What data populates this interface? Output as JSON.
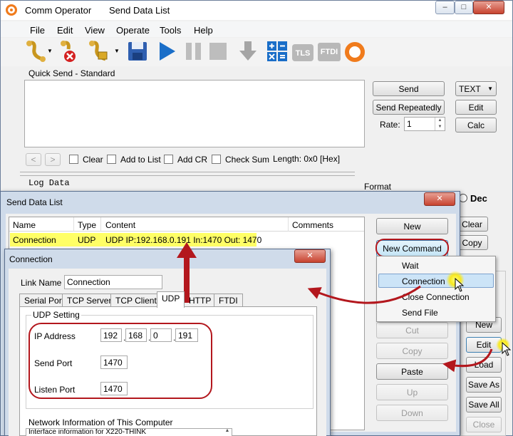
{
  "main_window": {
    "app_name": "Comm Operator",
    "doc_title": "Send Data List",
    "menu": [
      "File",
      "Edit",
      "View",
      "Operate",
      "Tools",
      "Help"
    ],
    "quick_send_title": "Quick Send - Standard",
    "send_label": "Send",
    "send_repeatedly_label": "Send Repeatedly",
    "rate_label": "Rate:",
    "rate_value": "1",
    "format_select": "TEXT",
    "edit_label": "Edit",
    "calc_label": "Calc",
    "prev_arrow": "<",
    "next_arrow": ">",
    "clear_label": "Clear",
    "add_to_list_label": "Add to List",
    "add_cr_label": "Add CR",
    "check_sum_label": "Check Sum",
    "length_text": "Length: 0x0 [Hex]",
    "log_data_label": "Log Data",
    "format_label": "Format",
    "dec_label": "Dec",
    "right_clear": "Clear",
    "right_copy": "Copy",
    "right_new": "New",
    "right_edit": "Edit",
    "right_load": "Load",
    "right_save_as": "Save As",
    "right_save_all": "Save All",
    "right_close": "Close",
    "toolbar_tls": "TLS",
    "toolbar_ftdi": "FTDI"
  },
  "send_data_list": {
    "title": "Send Data List",
    "columns": [
      "Name",
      "Type",
      "Content",
      "Comments"
    ],
    "rows": [
      {
        "name": "Connection",
        "type": "UDP",
        "content": "UDP IP:192.168.0.191 In:1470 Out: 1470",
        "comments": ""
      }
    ],
    "buttons": {
      "new": "New",
      "new_command": "New Command",
      "cut": "Cut",
      "copy": "Copy",
      "paste": "Paste",
      "up": "Up",
      "down": "Down"
    }
  },
  "context_menu": {
    "items": [
      "Wait",
      "Connection",
      "Close Connection",
      "Send File"
    ],
    "highlighted": "Connection"
  },
  "connection_dialog": {
    "title": "Connection",
    "link_name_label": "Link Name",
    "link_name_value": "Connection",
    "tabs": [
      "Serial Port",
      "TCP Server",
      "TCP Client",
      "UDP",
      "HTTP",
      "FTDI"
    ],
    "active_tab": "UDP",
    "udp_group_label": "UDP Setting",
    "ip_label": "IP Address",
    "ip_octets": [
      "192",
      "168",
      "0",
      "191"
    ],
    "send_port_label": "Send Port",
    "send_port_value": "1470",
    "listen_port_label": "Listen Port",
    "listen_port_value": "1470",
    "network_info_label": "Network Information of This Computer",
    "network_info_value": "Interface information for X220-THINK"
  },
  "colors": {
    "highlight_row": "#ffff66",
    "annotation_red": "#b3171d",
    "menu_highlight": "#cce4f7",
    "accent_blue": "#1a6ec8"
  }
}
